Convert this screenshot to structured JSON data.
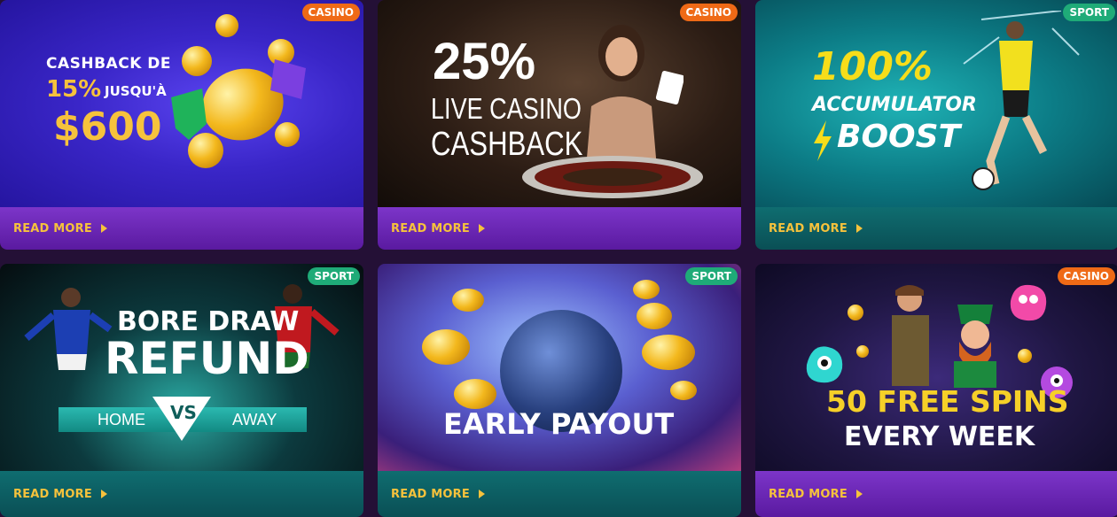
{
  "read_more_label": "READ MORE",
  "badges": {
    "casino": "CASINO",
    "sport": "SPORT"
  },
  "colors": {
    "casino_badge": "#ef6a16",
    "sport_badge": "#1fab78",
    "read_more": "#f6c23c"
  },
  "cards": [
    {
      "category": "CASINO",
      "lines": [
        "CASHBACK DE",
        "15%",
        "JUSQU'À",
        "$600"
      ]
    },
    {
      "category": "CASINO",
      "lines": [
        "25%",
        "LIVE CASINO",
        "CASHBACK"
      ]
    },
    {
      "category": "SPORT",
      "lines": [
        "100%",
        "ACCUMULATOR",
        "BOOST"
      ]
    },
    {
      "category": "SPORT",
      "lines": [
        "BORE DRAW",
        "REFUND",
        "HOME",
        "VS",
        "AWAY"
      ]
    },
    {
      "category": "SPORT",
      "lines": [
        "EARLY PAYOUT"
      ]
    },
    {
      "category": "CASINO",
      "lines": [
        "50 FREE SPINS",
        "EVERY WEEK"
      ]
    }
  ]
}
